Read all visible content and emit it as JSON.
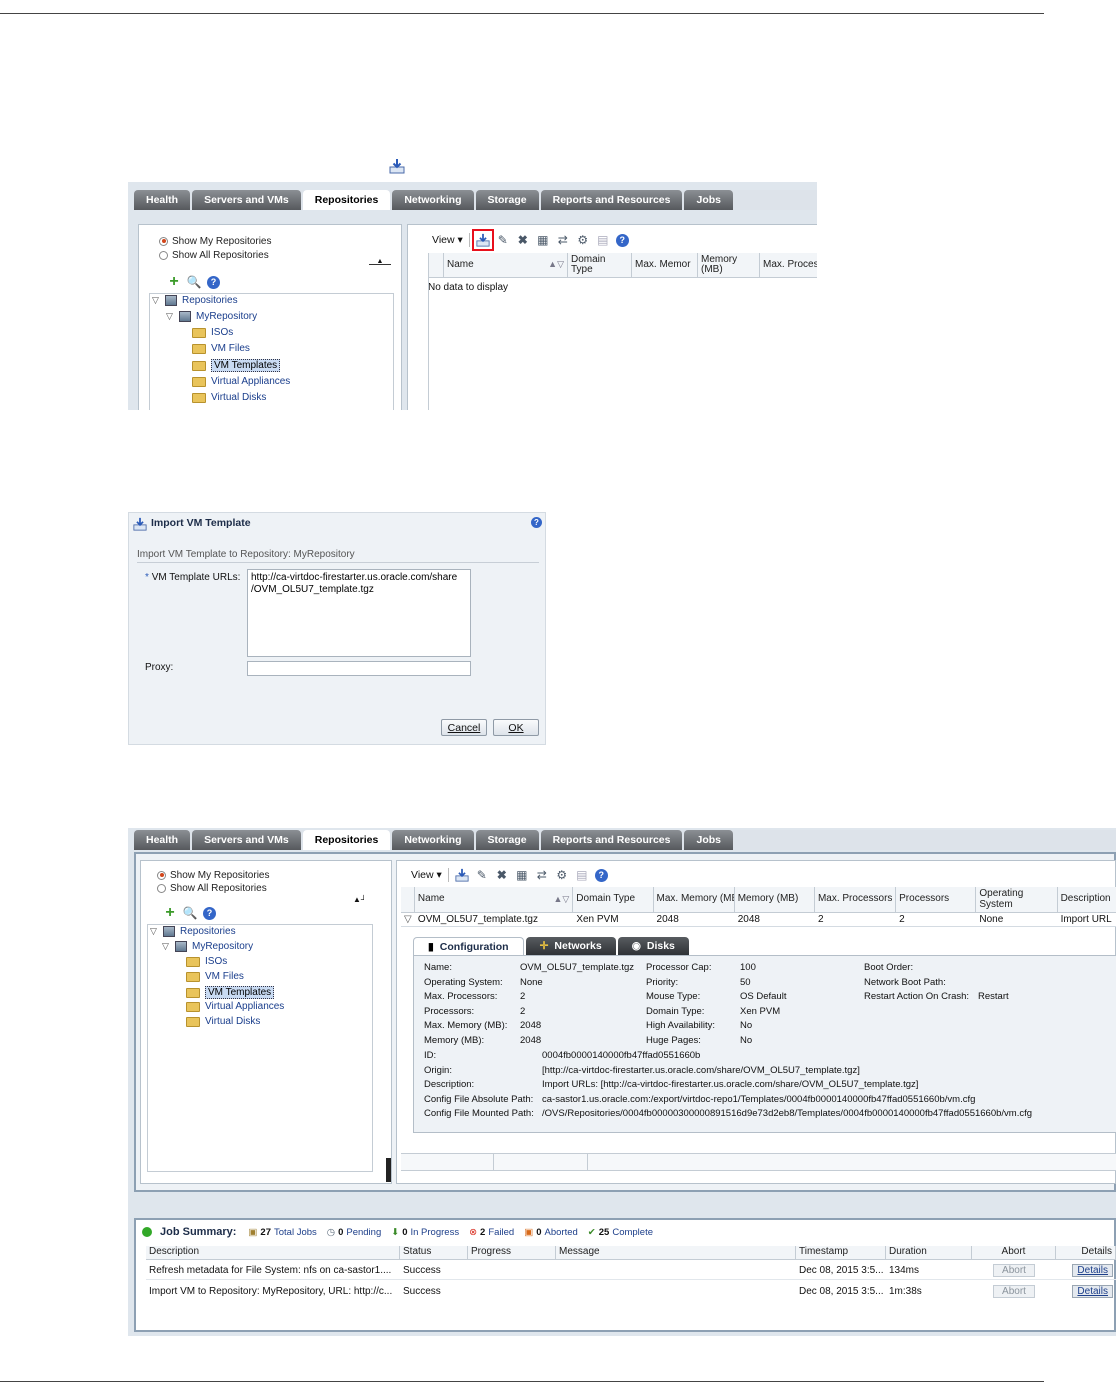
{
  "colors": {
    "accent": "#2a5ab8",
    "highlight_box": "#e8101c",
    "tab_active": "#ffffff",
    "tab_inactive": "#6e7276"
  },
  "inline_icon": "import-vm-template-icon",
  "screen1": {
    "tabs": [
      "Health",
      "Servers and VMs",
      "Repositories",
      "Networking",
      "Storage",
      "Reports and Resources",
      "Jobs"
    ],
    "radio": {
      "mine": "Show My Repositories",
      "all": "Show All Repositories"
    },
    "tree": {
      "root": "Repositories",
      "repo": "MyRepository",
      "folders": [
        "ISOs",
        "VM Files",
        "VM Templates",
        "Virtual Appliances",
        "Virtual Disks"
      ]
    },
    "view_label": "View",
    "columns": [
      "Name",
      "Domain Type",
      "Max. Memor",
      "Memory (MB)",
      "Max. Proces"
    ],
    "empty_text": "No data to display"
  },
  "dialog": {
    "title": "Import VM Template",
    "subtitle": "Import VM Template to Repository: MyRepository",
    "url_label": "VM Template URLs:",
    "required_mark": "*",
    "url_value": "http://ca-virtdoc-firestarter.us.oracle.com/share\n/OVM_OL5U7_template.tgz",
    "proxy_label": "Proxy:",
    "proxy_value": "",
    "cancel": "Cancel",
    "ok": "OK"
  },
  "screen3": {
    "tabs": [
      "Health",
      "Servers and VMs",
      "Repositories",
      "Networking",
      "Storage",
      "Reports and Resources",
      "Jobs"
    ],
    "radio": {
      "mine": "Show My Repositories",
      "all": "Show All Repositories"
    },
    "tree": {
      "root": "Repositories",
      "repo": "MyRepository",
      "folders": [
        "ISOs",
        "VM Files",
        "VM Templates",
        "Virtual Appliances",
        "Virtual Disks"
      ]
    },
    "view_label": "View",
    "columns": [
      "Name",
      "Domain Type",
      "Max. Memory (MB",
      "Memory (MB)",
      "Max. Processors",
      "Processors",
      "Operating System",
      "Description"
    ],
    "row": [
      "OVM_OL5U7_template.tgz",
      "Xen PVM",
      "2048",
      "2048",
      "2",
      "2",
      "None",
      "Import URL"
    ],
    "detail_tabs": [
      "Configuration",
      "Networks",
      "Disks"
    ],
    "details": {
      "col1": [
        [
          "Name:",
          "OVM_OL5U7_template.tgz"
        ],
        [
          "Operating System:",
          "None"
        ],
        [
          "Max. Processors:",
          "2"
        ],
        [
          "Processors:",
          "2"
        ],
        [
          "Max. Memory (MB):",
          "2048"
        ],
        [
          "Memory (MB):",
          "2048"
        ]
      ],
      "col2": [
        [
          "Processor Cap:",
          "100"
        ],
        [
          "Priority:",
          "50"
        ],
        [
          "Mouse Type:",
          "OS Default"
        ],
        [
          "Domain Type:",
          "Xen PVM"
        ],
        [
          "High Availability:",
          "No"
        ],
        [
          "Huge Pages:",
          "No"
        ]
      ],
      "col3": [
        [
          "Boot Order:",
          ""
        ],
        [
          "Network Boot Path:",
          ""
        ],
        [
          "Restart Action On Crash:",
          "Restart"
        ]
      ],
      "wide": [
        [
          "ID:",
          "0004fb0000140000fb47ffad0551660b"
        ],
        [
          "Origin:",
          "[http://ca-virtdoc-firestarter.us.oracle.com/share/OVM_OL5U7_template.tgz]"
        ],
        [
          "Description:",
          "Import URLs: [http://ca-virtdoc-firestarter.us.oracle.com/share/OVM_OL5U7_template.tgz]"
        ],
        [
          "Config File Absolute Path:",
          "ca-sastor1.us.oracle.com:/export/virtdoc-repo1/Templates/0004fb0000140000fb47ffad0551660b/vm.cfg"
        ],
        [
          "Config File Mounted Path:",
          "/OVS/Repositories/0004fb00000300000891516d9e73d2eb8/Templates/0004fb0000140000fb47ffad0551660b/vm.cfg"
        ]
      ]
    },
    "job_summary": {
      "title": "Job Summary:",
      "stats": [
        [
          "27",
          "Total Jobs"
        ],
        [
          "0",
          "Pending"
        ],
        [
          "0",
          "In Progress"
        ],
        [
          "2",
          "Failed"
        ],
        [
          "0",
          "Aborted"
        ],
        [
          "25",
          "Complete"
        ]
      ],
      "columns": [
        "Description",
        "Status",
        "Progress",
        "Message",
        "Timestamp",
        "Duration",
        "Abort",
        "Details"
      ],
      "rows": [
        [
          "Refresh metadata for File System: nfs on ca-sastor1....",
          "Success",
          "",
          "",
          "Dec 08, 2015 3:5...",
          "134ms",
          "Abort",
          "Details"
        ],
        [
          "Import VM to Repository: MyRepository, URL: http://c...",
          "Success",
          "",
          "",
          "Dec 08, 2015 3:5...",
          "1m:38s",
          "Abort",
          "Details"
        ]
      ]
    }
  }
}
